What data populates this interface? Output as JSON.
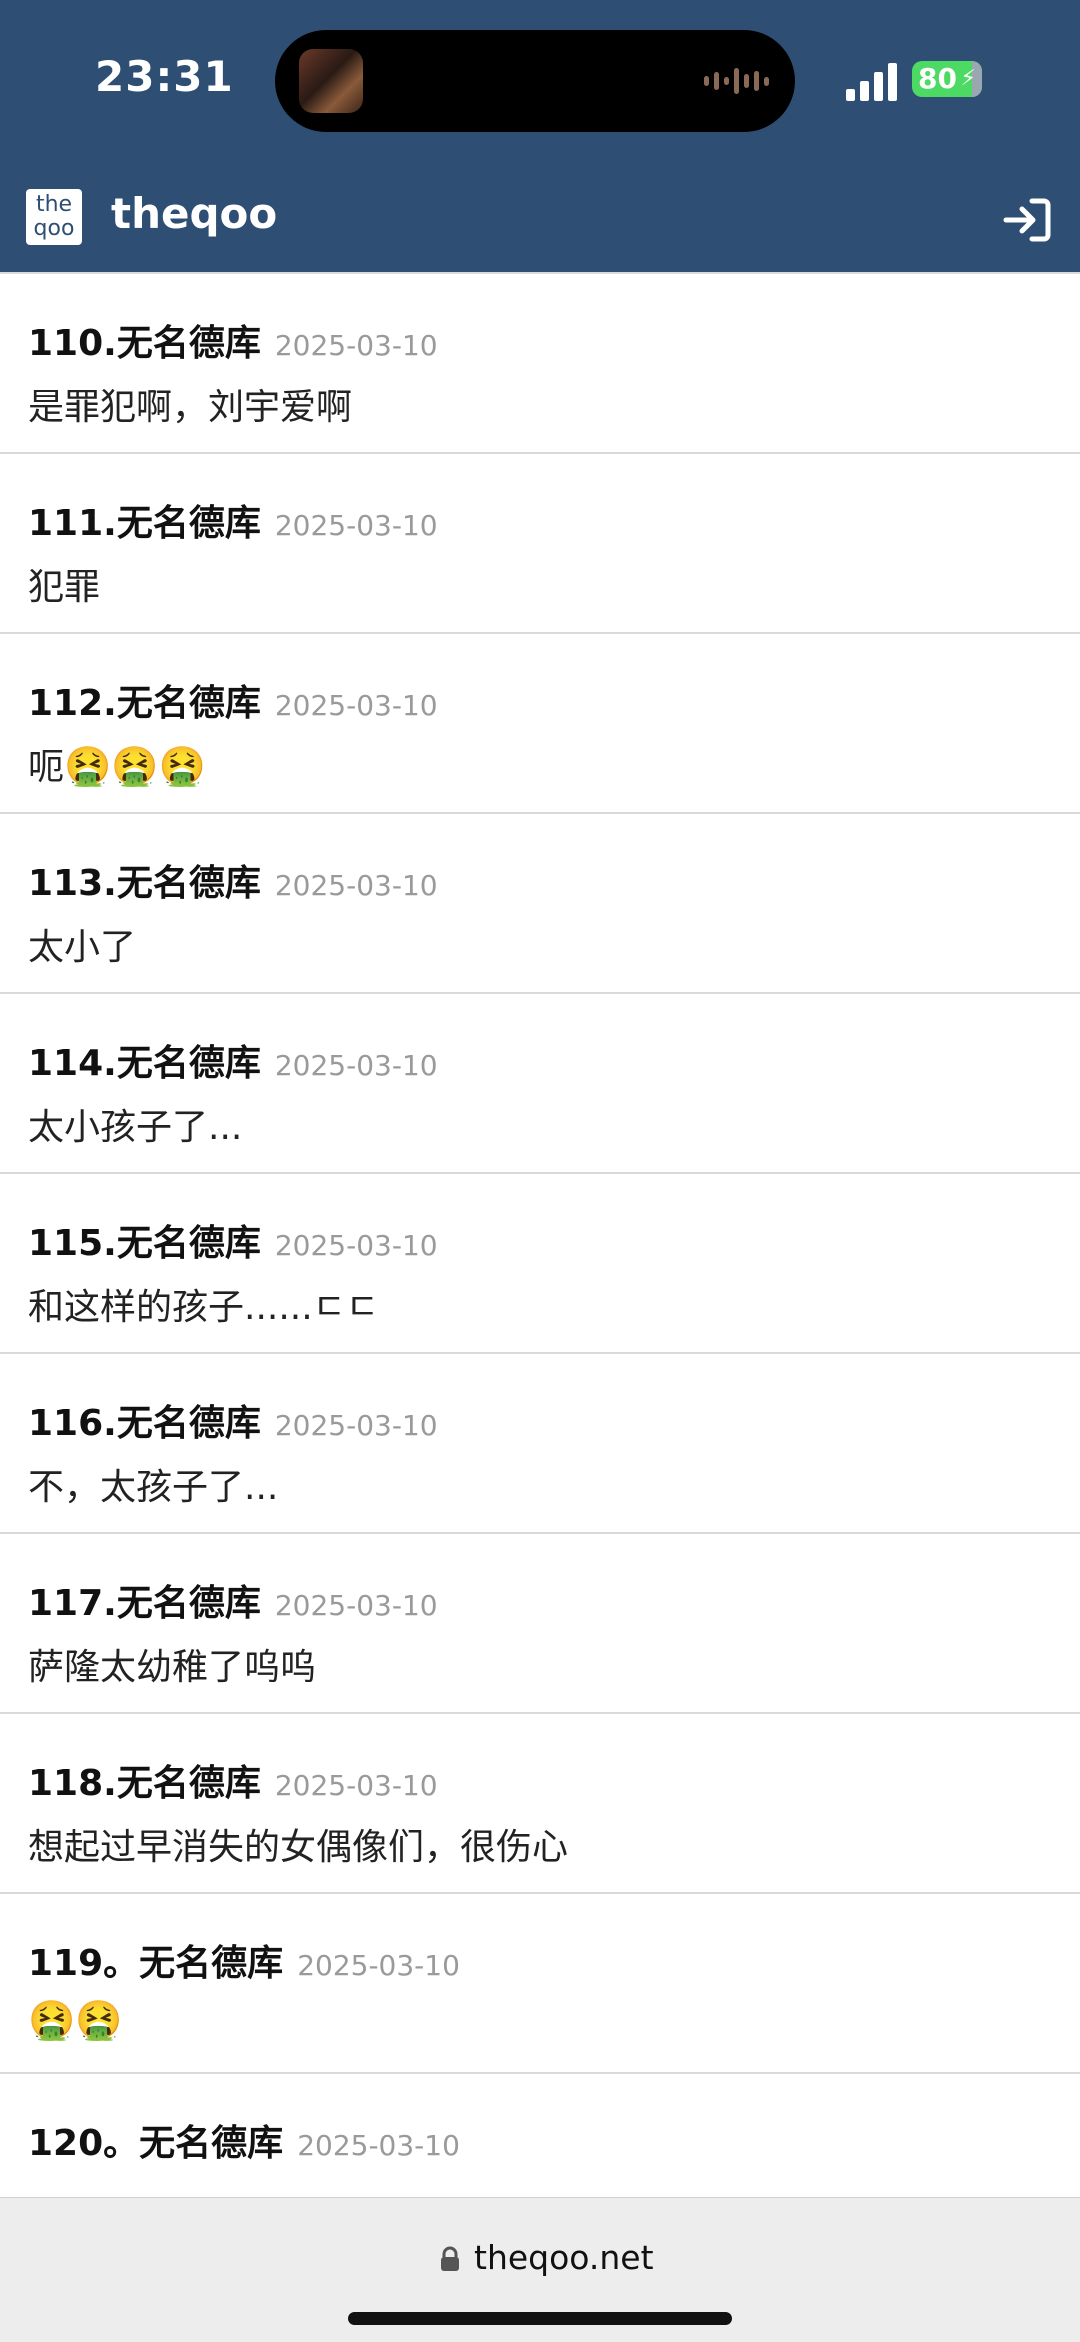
{
  "status": {
    "time": "23:31",
    "battery": "80"
  },
  "header": {
    "logo": "the qoo",
    "title": "theqoo"
  },
  "comments": [
    {
      "id": "110",
      "sep": ".",
      "author": "无名德库",
      "date": "2025-03-10",
      "text": "是罪犯啊，刘宇爱啊"
    },
    {
      "id": "111",
      "sep": ".",
      "author": "无名德库",
      "date": "2025-03-10",
      "text": "犯罪"
    },
    {
      "id": "112",
      "sep": ".",
      "author": "无名德库",
      "date": "2025-03-10",
      "text": "呃",
      "emoji": "🤮🤮🤮"
    },
    {
      "id": "113",
      "sep": ".",
      "author": "无名德库",
      "date": "2025-03-10",
      "text": "太小了"
    },
    {
      "id": "114",
      "sep": ".",
      "author": "无名德库",
      "date": "2025-03-10",
      "text": "太小孩子了..."
    },
    {
      "id": "115",
      "sep": ".",
      "author": "无名德库",
      "date": "2025-03-10",
      "text": "和这样的孩子......ㄷㄷ"
    },
    {
      "id": "116",
      "sep": ".",
      "author": "无名德库",
      "date": "2025-03-10",
      "text": "不，太孩子了..."
    },
    {
      "id": "117",
      "sep": ".",
      "author": "无名德库",
      "date": "2025-03-10",
      "text": "萨隆太幼稚了呜呜"
    },
    {
      "id": "118",
      "sep": ".",
      "author": "无名德库",
      "date": "2025-03-10",
      "text": "想起过早消失的女偶像们，很伤心"
    },
    {
      "id": "119",
      "sep": "。",
      "author": "无名德库",
      "date": "2025-03-10",
      "text": "",
      "emoji": "🤮🤮"
    },
    {
      "id": "120",
      "sep": "。",
      "author": "无名德库",
      "date": "2025-03-10",
      "text": ""
    }
  ],
  "browser": {
    "url": "theqoo.net"
  },
  "colors": {
    "header_bg": "#2e4f73",
    "battery": "#4cd964",
    "date": "#9a9a9a"
  },
  "icons": {
    "login": "sign-in-icon",
    "lock": "lock-icon",
    "signal": "signal-icon"
  }
}
